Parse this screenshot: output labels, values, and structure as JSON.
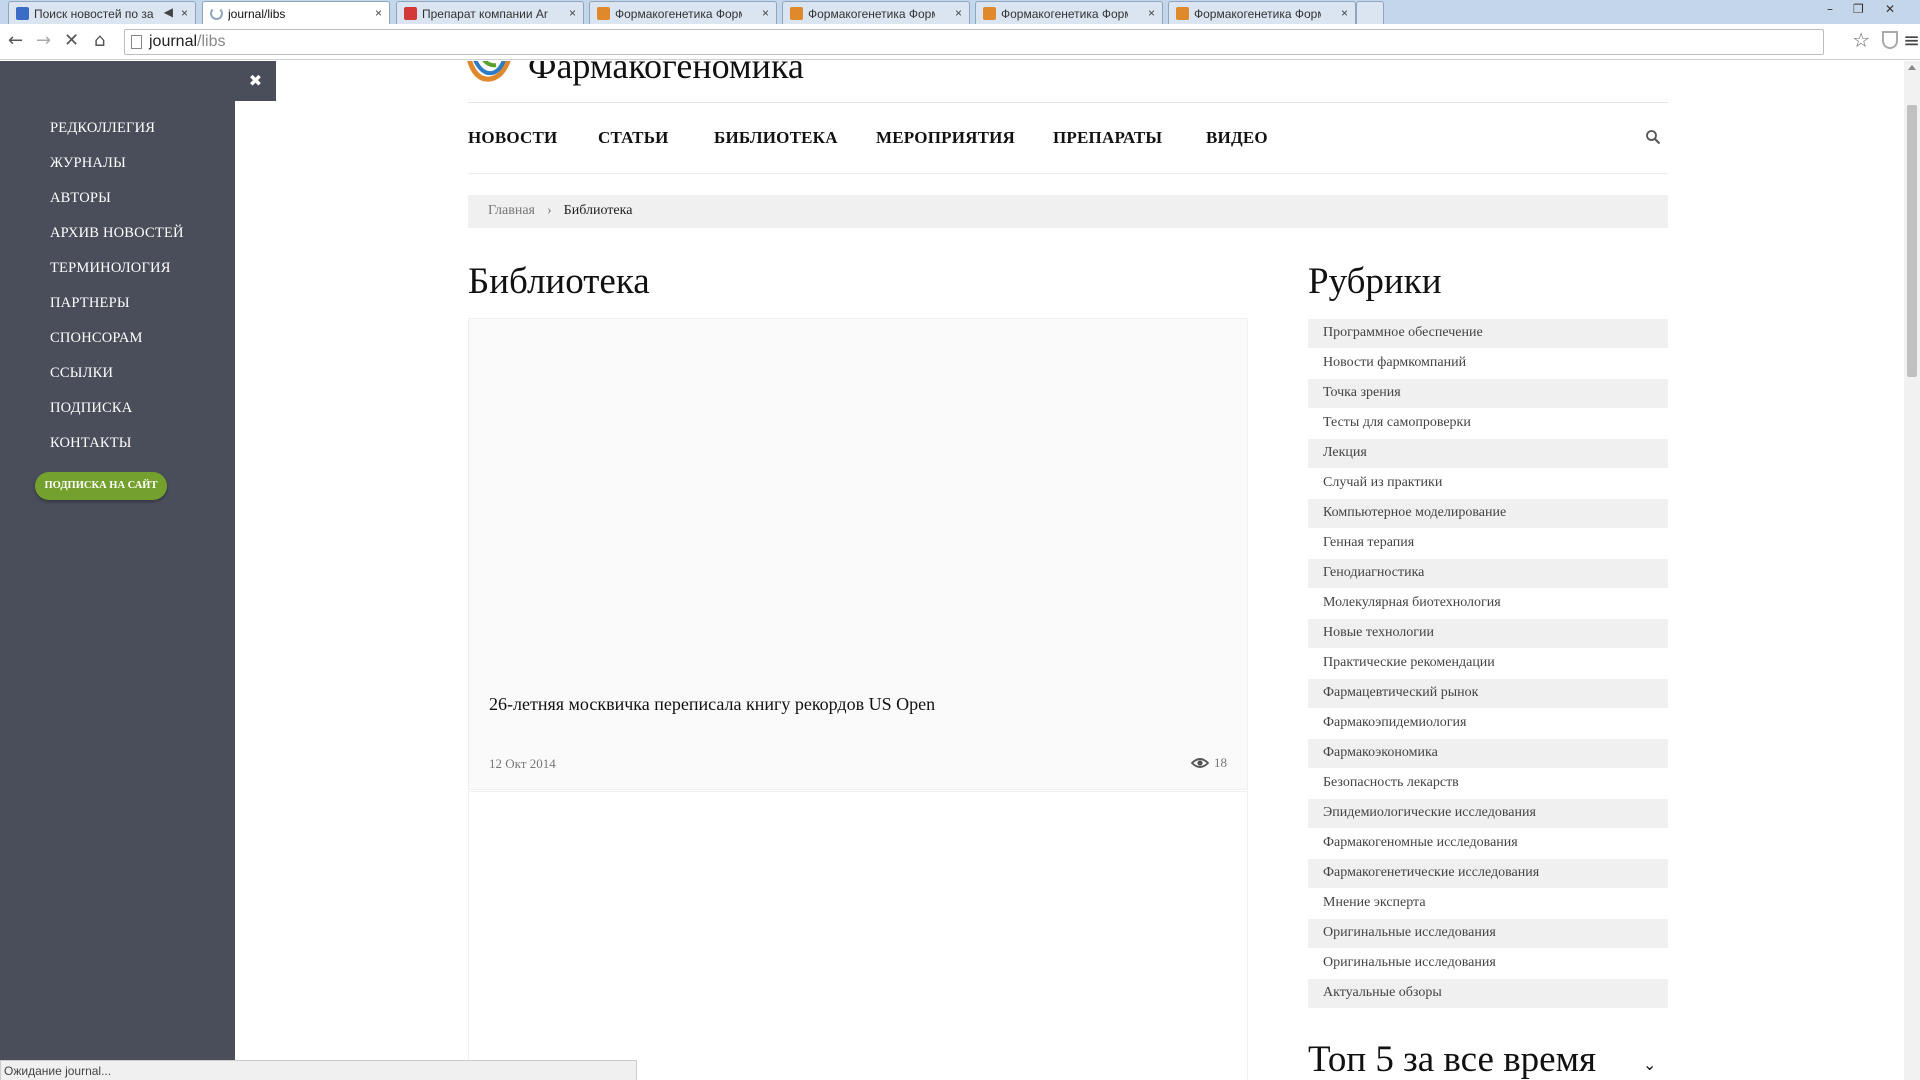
{
  "browser": {
    "tabs": [
      {
        "title": "Поиск новостей по за",
        "favicon_color": "#3b6dc7",
        "active": false,
        "muted_icon": true
      },
      {
        "title": "journal/libs",
        "favicon_color": "",
        "active": true,
        "loading": true
      },
      {
        "title": "Препарат компании Ar",
        "favicon_color": "#d23a3a",
        "active": false
      },
      {
        "title": "Формакогенетика Форм",
        "favicon_color": "#e0892c",
        "active": false
      },
      {
        "title": "Формакогенетика Форм",
        "favicon_color": "#e0892c",
        "active": false
      },
      {
        "title": "Формакогенетика Форм",
        "favicon_color": "#e0892c",
        "active": false
      },
      {
        "title": "Формакогенетика Форм",
        "favicon_color": "#e0892c",
        "active": false
      }
    ],
    "url_host": "journal",
    "url_path": "/libs",
    "status": "Ожидание journal..."
  },
  "sidebar": {
    "items": [
      "Редколлегия",
      "Журналы",
      "Авторы",
      "Архив новостей",
      "Терминология",
      "Партнеры",
      "Спонсорам",
      "Ссылки",
      "Подписка",
      "Контакты"
    ],
    "subscribe_button": "Подписка на сайт",
    "close_label": "✖"
  },
  "site": {
    "title": "Фармакогеномика",
    "nav": [
      "Новости",
      "Статьи",
      "Библиотека",
      "Мероприятия",
      "Препараты",
      "Видео"
    ]
  },
  "breadcrumb": {
    "home": "Главная",
    "separator": "›",
    "current": "Библиотека"
  },
  "main": {
    "title": "Библиотека",
    "cards": [
      {
        "title": "26-летняя москвичка переписала книгу рекордов US Open",
        "date": "12 Окт 2014",
        "views": "18"
      }
    ]
  },
  "rubrics": {
    "title": "Рубрики",
    "items": [
      "Программное обеспечение",
      "Новости фармкомпаний",
      "Точка зрения",
      "Тесты для самопроверки",
      "Лекция",
      "Случай из практики",
      "Компьютерное моделирование",
      "Генная терапия",
      "Генодиагностика",
      "Молекулярная биотехнология",
      "Новые технологии",
      "Практические рекомендации",
      "Фармацевтический рынок",
      "Фармакоэпидемиология",
      "Фармакоэкономика",
      "Безопасность лекарств",
      "Эпидемиологические исследования",
      "Фармакогеномные исследования",
      "Фармакогенетические исследования",
      "Мнение эксперта",
      "Оригинальные исследования",
      "Оригинальные исследования",
      "Актуальные обзоры"
    ]
  },
  "top5": {
    "title": "Топ 5 за все время"
  },
  "colors": {
    "sidebar_bg": "#494e5a",
    "subscribe_green": "#74a12e"
  }
}
